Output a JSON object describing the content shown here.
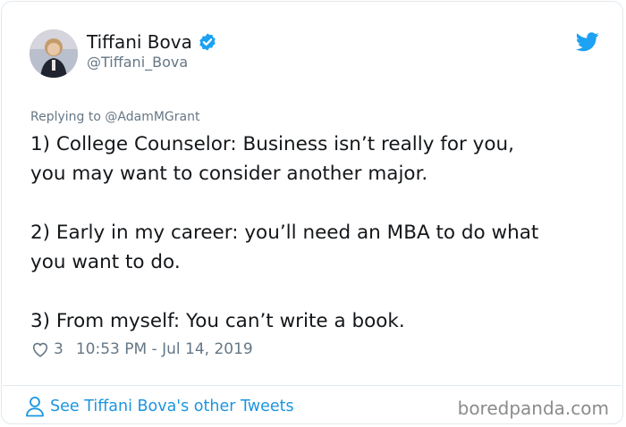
{
  "tweet": {
    "author": {
      "display_name": "Tiffani Bova",
      "handle": "@Tiffani_Bova",
      "verified": true
    },
    "reply": {
      "prefix": "Replying to ",
      "mention": "@AdamMGrant"
    },
    "lines": [
      "1) College Counselor: Business isn’t really for you,",
      "you may want to consider another major.",
      "2) Early in my career: you’ll need an MBA to do what",
      "you want to do.",
      "3) From myself: You can’t write a book."
    ],
    "like_count": "3",
    "timestamp": "10:53 PM - Jul 14, 2019",
    "footer_link": "See Tiffani Bova's other Tweets"
  },
  "watermark": "boredpanda.com",
  "colors": {
    "twitter_blue": "#1da1f2",
    "link_blue": "#1b95e0",
    "text": "#14171a",
    "muted": "#657786",
    "border": "#e1e8ed"
  },
  "icons": {
    "verified": "verified-badge-icon",
    "logo": "twitter-bird-icon",
    "like": "heart-icon",
    "profile": "person-icon"
  }
}
